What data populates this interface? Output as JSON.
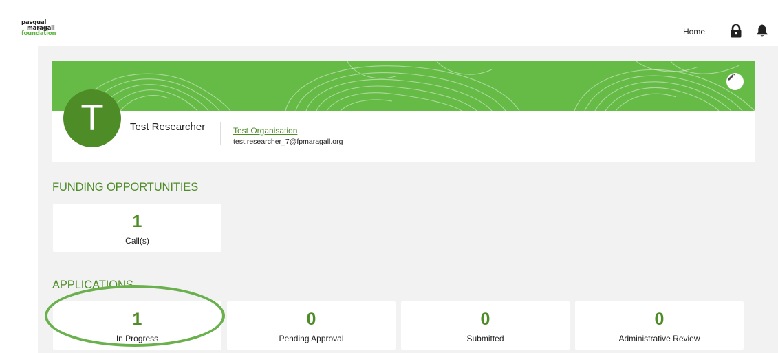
{
  "header": {
    "logo_line1": "pasqual",
    "logo_line2": "maragall",
    "logo_line3": "foundation",
    "home_label": "Home",
    "icons": [
      "lock-icon",
      "bell-icon"
    ]
  },
  "profile": {
    "avatar_initial": "T",
    "name": "Test Researcher",
    "organisation": "Test Organisation",
    "email": "test.researcher_7@fpmaragall.org",
    "edit_icon": "pencil-icon"
  },
  "funding": {
    "title": "FUNDING OPPORTUNITIES",
    "cards": [
      {
        "count": "1",
        "label": "Call(s)"
      }
    ]
  },
  "applications": {
    "title": "APPLICATIONS",
    "cards": [
      {
        "count": "1",
        "label": "In Progress"
      },
      {
        "count": "0",
        "label": "Pending Approval"
      },
      {
        "count": "0",
        "label": "Submitted"
      },
      {
        "count": "0",
        "label": "Administrative Review"
      }
    ]
  },
  "colors": {
    "brand_green": "#4e8c28",
    "banner_green": "#66bb47",
    "logo_green": "#5fb544",
    "highlight_green": "#6ab04c"
  }
}
